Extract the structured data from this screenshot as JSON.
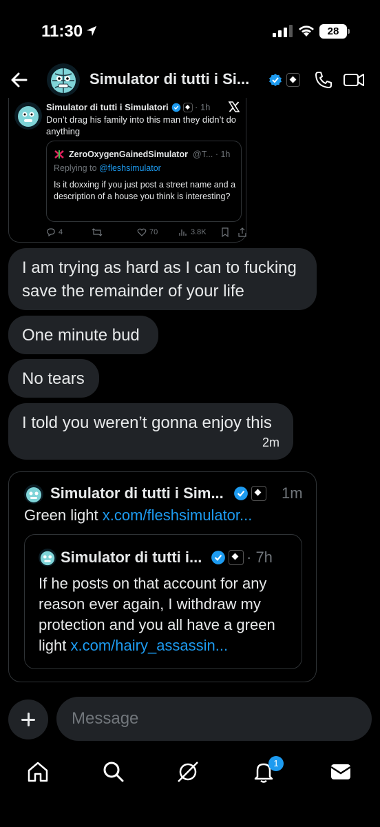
{
  "status_bar": {
    "time": "11:30",
    "battery": "28"
  },
  "header": {
    "title": "Simulator di tutti i Si..."
  },
  "tweet_card": {
    "author": "Simulator di tutti i Simulatori",
    "time": "· 1h",
    "text": "Don’t drag his family into this man they didn’t do anything",
    "quote": {
      "author": "ZeroOxygenGainedSimulator",
      "handle": "@T... · 1h",
      "replying_prefix": "Replying to ",
      "replying_to": "@fleshsimulator",
      "text": "Is it doxxing if you just post a street name and a description of a house you think is interesting?"
    },
    "actions": {
      "replies": "4",
      "retweets": "",
      "likes": "70",
      "views": "3.8K"
    }
  },
  "messages": [
    {
      "text": "I am trying as hard as I can to fucking save the remainder of your life"
    },
    {
      "text": "One minute bud"
    },
    {
      "text": "No tears"
    },
    {
      "text": "I told you weren’t gonna enjoy this",
      "time": "2m"
    }
  ],
  "shared_post": {
    "author": "Simulator di tutti i Sim...",
    "time": "1m",
    "text_prefix": "Green light ",
    "link": "x.com/fleshsimulator...",
    "quote": {
      "author": "Simulator di tutti i...",
      "time": "· 7h",
      "text": "If he posts on that account for any reason ever again, I withdraw my protection and you all have a green light ",
      "link": "x.com/hairy_assassin..."
    }
  },
  "composer": {
    "placeholder": "Message"
  },
  "nav": {
    "notifications_badge": "1"
  },
  "colors": {
    "accent": "#1d9bf0",
    "bubble": "#202327",
    "muted": "#71767b"
  },
  "icons": [
    "back-arrow-icon",
    "phone-icon",
    "video-camera-icon",
    "x-logo-icon",
    "home-icon",
    "search-icon",
    "grok-icon",
    "bell-icon",
    "mail-icon",
    "plus-icon"
  ]
}
